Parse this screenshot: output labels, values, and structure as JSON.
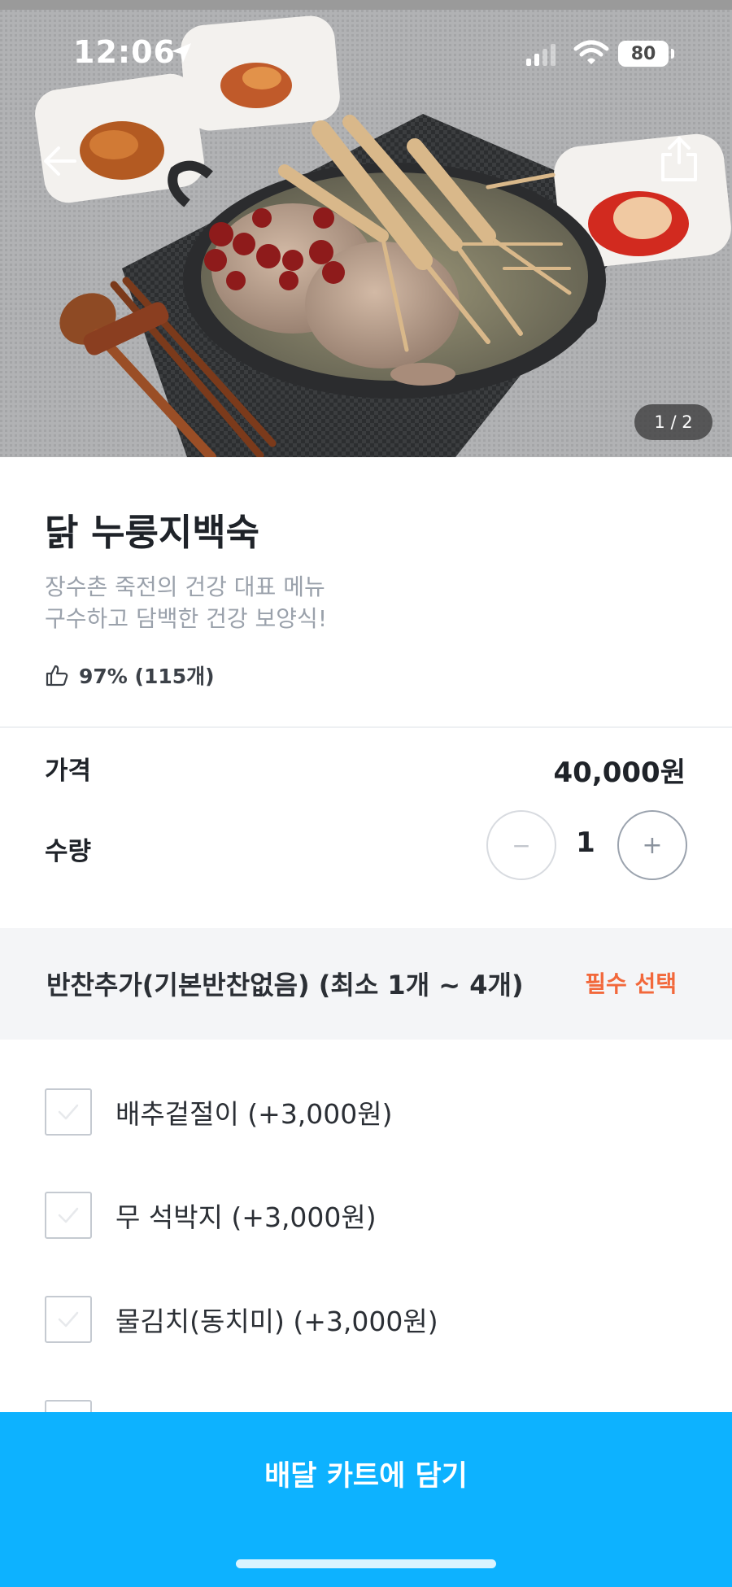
{
  "status_bar": {
    "time": "12:06",
    "battery": "80"
  },
  "hero": {
    "page_indicator": "1 / 2"
  },
  "product": {
    "title": "닭 누룽지백숙",
    "description_line1": "장수촌 죽전의 건강 대표 메뉴",
    "description_line2": "구수하고 담백한 건강 보양식!",
    "rating": "97% (115개)"
  },
  "price": {
    "label": "가격",
    "value": "40,000원"
  },
  "quantity": {
    "label": "수량",
    "value": "1",
    "minus": "−",
    "plus": "+"
  },
  "options": {
    "title": "반찬추가(기본반찬없음) (최소 1개 ~ 4개)",
    "required": "필수 선택",
    "items": [
      {
        "label": "배추겉절이 (+3,000원)"
      },
      {
        "label": "무 석박지 (+3,000원)"
      },
      {
        "label": "물김치(동치미) (+3,000원)"
      }
    ]
  },
  "cta": {
    "label": "배달 카트에 담기"
  },
  "colors": {
    "accent": "#0db2ff",
    "required": "#f2683b",
    "muted_text": "#9aa1ab"
  }
}
